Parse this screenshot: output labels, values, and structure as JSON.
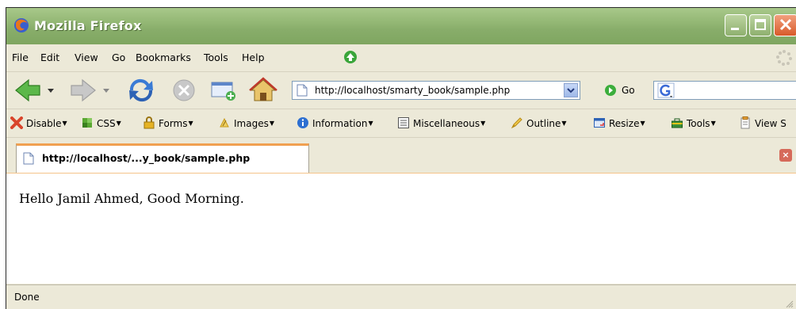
{
  "window": {
    "title": "Mozilla Firefox"
  },
  "menubar": {
    "items": [
      "File",
      "Edit",
      "View",
      "Go",
      "Bookmarks",
      "Tools",
      "Help"
    ]
  },
  "navigation": {
    "url": "http://localhost/smarty_book/sample.php",
    "go_label": "Go"
  },
  "web_developer_toolbar": {
    "items": [
      "Disable",
      "CSS",
      "Forms",
      "Images",
      "Information",
      "Miscellaneous",
      "Outline",
      "Resize",
      "Tools",
      "View S"
    ]
  },
  "tab": {
    "label": "http://localhost/...y_book/sample.php"
  },
  "page": {
    "text": "Hello Jamil Ahmed, Good Morning."
  },
  "status": {
    "text": "Done"
  },
  "colors": {
    "titlebar": "#88ad6a",
    "tab_highlight": "#f0a050",
    "chrome": "#ece9d8"
  }
}
